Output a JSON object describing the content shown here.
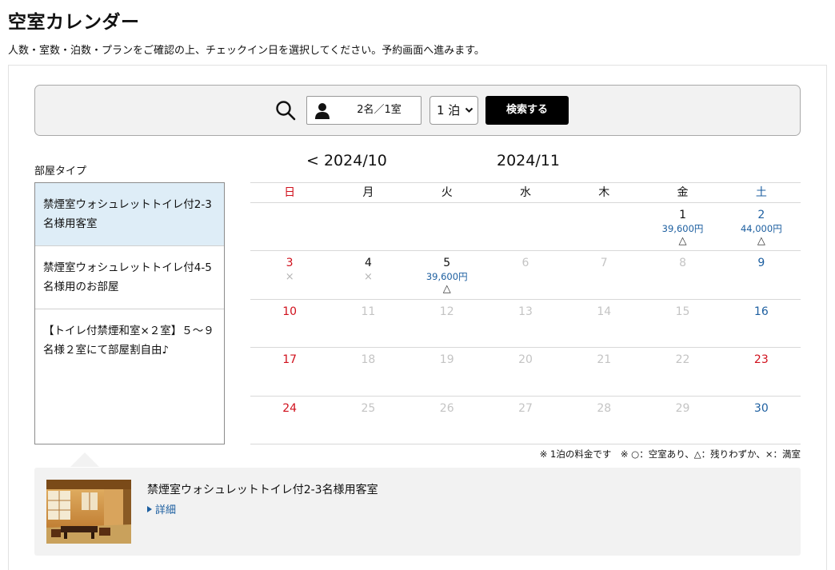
{
  "page": {
    "title": "空室カレンダー",
    "subtitle": "人数・室数・泊数・プランをご確認の上、チェックイン日を選択してください。予約画面へ進みます。"
  },
  "search": {
    "icon": "search-icon",
    "guests_value": "2名／1室",
    "nights_value": "1 泊",
    "button_label": "検索する"
  },
  "rooms": {
    "label": "部屋タイプ",
    "items": [
      {
        "name": "禁煙室ウォシュレットトイレ付2-3名様用客室",
        "selected": true
      },
      {
        "name": "禁煙室ウォシュレットトイレ付4-5名様用のお部屋",
        "selected": false
      },
      {
        "name": "【トイレ付禁煙和室×２室】５～９名様２室にて部屋割自由♪",
        "selected": false
      }
    ]
  },
  "calendar": {
    "prev_month": "< 2024/10",
    "current_month": "2024/11",
    "weekdays": [
      "日",
      "月",
      "火",
      "水",
      "木",
      "金",
      "土"
    ],
    "weeks": [
      [
        {
          "day": "",
          "price": "",
          "mark": "",
          "state": "empty"
        },
        {
          "day": "",
          "price": "",
          "mark": "",
          "state": "empty"
        },
        {
          "day": "",
          "price": "",
          "mark": "",
          "state": "empty"
        },
        {
          "day": "",
          "price": "",
          "mark": "",
          "state": "empty"
        },
        {
          "day": "",
          "price": "",
          "mark": "",
          "state": "empty"
        },
        {
          "day": "1",
          "price": "39,600円",
          "mark": "△",
          "state": "available"
        },
        {
          "day": "2",
          "price": "44,000円",
          "mark": "△",
          "state": "available"
        }
      ],
      [
        {
          "day": "3",
          "price": "",
          "mark": "×",
          "state": "full"
        },
        {
          "day": "4",
          "price": "",
          "mark": "×",
          "state": "full"
        },
        {
          "day": "5",
          "price": "39,600円",
          "mark": "△",
          "state": "available"
        },
        {
          "day": "6",
          "price": "",
          "mark": "",
          "state": "disabled"
        },
        {
          "day": "7",
          "price": "",
          "mark": "",
          "state": "disabled"
        },
        {
          "day": "8",
          "price": "",
          "mark": "",
          "state": "disabled"
        },
        {
          "day": "9",
          "price": "",
          "mark": "",
          "state": "full"
        }
      ],
      [
        {
          "day": "10",
          "price": "",
          "mark": "",
          "state": "full"
        },
        {
          "day": "11",
          "price": "",
          "mark": "",
          "state": "disabled"
        },
        {
          "day": "12",
          "price": "",
          "mark": "",
          "state": "disabled"
        },
        {
          "day": "13",
          "price": "",
          "mark": "",
          "state": "disabled"
        },
        {
          "day": "14",
          "price": "",
          "mark": "",
          "state": "disabled"
        },
        {
          "day": "15",
          "price": "",
          "mark": "",
          "state": "disabled"
        },
        {
          "day": "16",
          "price": "",
          "mark": "",
          "state": "full"
        }
      ],
      [
        {
          "day": "17",
          "price": "",
          "mark": "",
          "state": "full"
        },
        {
          "day": "18",
          "price": "",
          "mark": "",
          "state": "disabled"
        },
        {
          "day": "19",
          "price": "",
          "mark": "",
          "state": "disabled"
        },
        {
          "day": "20",
          "price": "",
          "mark": "",
          "state": "disabled"
        },
        {
          "day": "21",
          "price": "",
          "mark": "",
          "state": "disabled"
        },
        {
          "day": "22",
          "price": "",
          "mark": "",
          "state": "disabled"
        },
        {
          "day": "23",
          "price": "",
          "mark": "",
          "state": "holiday"
        }
      ],
      [
        {
          "day": "24",
          "price": "",
          "mark": "",
          "state": "full"
        },
        {
          "day": "25",
          "price": "",
          "mark": "",
          "state": "disabled"
        },
        {
          "day": "26",
          "price": "",
          "mark": "",
          "state": "disabled"
        },
        {
          "day": "27",
          "price": "",
          "mark": "",
          "state": "disabled"
        },
        {
          "day": "28",
          "price": "",
          "mark": "",
          "state": "disabled"
        },
        {
          "day": "29",
          "price": "",
          "mark": "",
          "state": "disabled"
        },
        {
          "day": "30",
          "price": "",
          "mark": "",
          "state": "full"
        }
      ]
    ],
    "legend": "※ 1泊の料金です　※ ○：空室あり、△：残りわずか、×：満室"
  },
  "detail": {
    "room_name": "禁煙室ウォシュレットトイレ付2-3名様用客室",
    "link_label": "詳細"
  },
  "colors": {
    "sunday": "#d0101c",
    "saturday": "#1d5fa0",
    "price": "#1d5fa0",
    "disabled": "#c4c4c4",
    "selected_room_bg": "#deedf7",
    "button_bg": "#000000"
  }
}
